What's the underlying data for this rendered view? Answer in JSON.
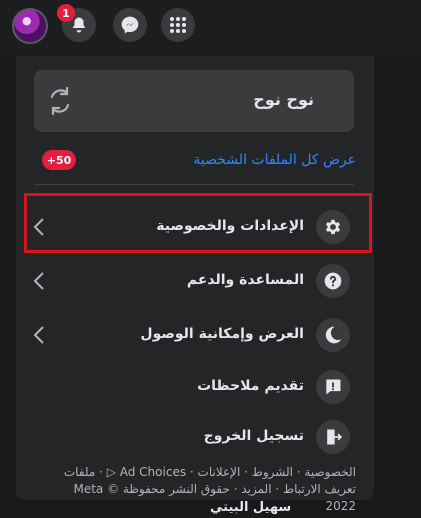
{
  "topbar": {
    "notification_count": "1",
    "icons": [
      "avatar",
      "bell-icon",
      "messenger-icon",
      "menu-grid-icon"
    ]
  },
  "profile": {
    "name": "نوح نوح",
    "view_all": "عرض كل الملفات الشخصية",
    "badge": "+50"
  },
  "menu": {
    "items": [
      {
        "label": "الإعدادات والخصوصية",
        "icon": "gear-icon"
      },
      {
        "label": "المساعدة والدعم",
        "icon": "help-icon"
      },
      {
        "label": "العرض وإمكانية الوصول",
        "icon": "moon-icon"
      },
      {
        "label": "تقديم ملاحظات",
        "icon": "feedback-icon"
      },
      {
        "label": "تسجيل الخروج",
        "icon": "logout-icon"
      }
    ]
  },
  "footer": {
    "line1": "الخصوصية · الشروط · الإعلانات · Ad Choices ▷ · ملفات",
    "line2": "تعريف الارتباط · المزيد · حقوق النشر محفوظة Meta © 2022"
  },
  "background_text": "سهيل البيتي",
  "colors": {
    "accent": "#2d88ff",
    "badge": "#e41e3f",
    "highlight": "#d7141a",
    "panel": "#242526"
  }
}
